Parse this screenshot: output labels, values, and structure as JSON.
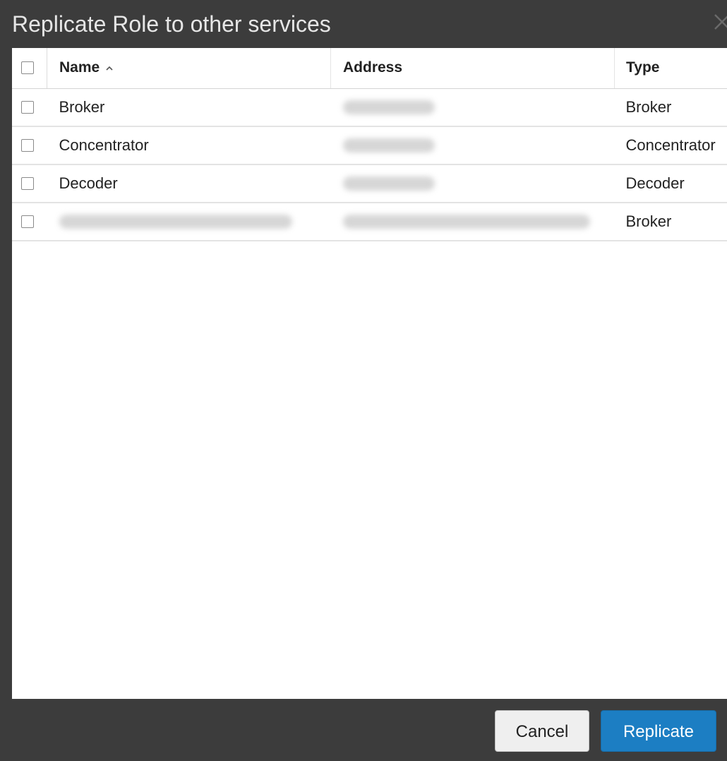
{
  "dialog": {
    "title": "Replicate Role to other services",
    "close_icon": "close-icon"
  },
  "table": {
    "columns": {
      "name": "Name",
      "address": "Address",
      "type": "Type"
    },
    "sort": {
      "column": "name",
      "direction": "ascending",
      "icon": "chevron-up-icon"
    },
    "rows": [
      {
        "name": "Broker",
        "address": "",
        "type": "Broker",
        "name_redacted": false,
        "address_redacted": true,
        "checked": false
      },
      {
        "name": "Concentrator",
        "address": "",
        "type": "Concentrator",
        "name_redacted": false,
        "address_redacted": true,
        "checked": false
      },
      {
        "name": "Decoder",
        "address": "",
        "type": "Decoder",
        "name_redacted": false,
        "address_redacted": true,
        "checked": false
      },
      {
        "name": "",
        "address": "",
        "type": "Broker",
        "name_redacted": true,
        "address_redacted": true,
        "checked": false
      }
    ]
  },
  "footer": {
    "cancel_label": "Cancel",
    "replicate_label": "Replicate"
  },
  "colors": {
    "dialog_bg": "#3c3c3c",
    "title_text": "#e6e6e6",
    "primary_button": "#1c7ec3",
    "secondary_button": "#efefef"
  }
}
